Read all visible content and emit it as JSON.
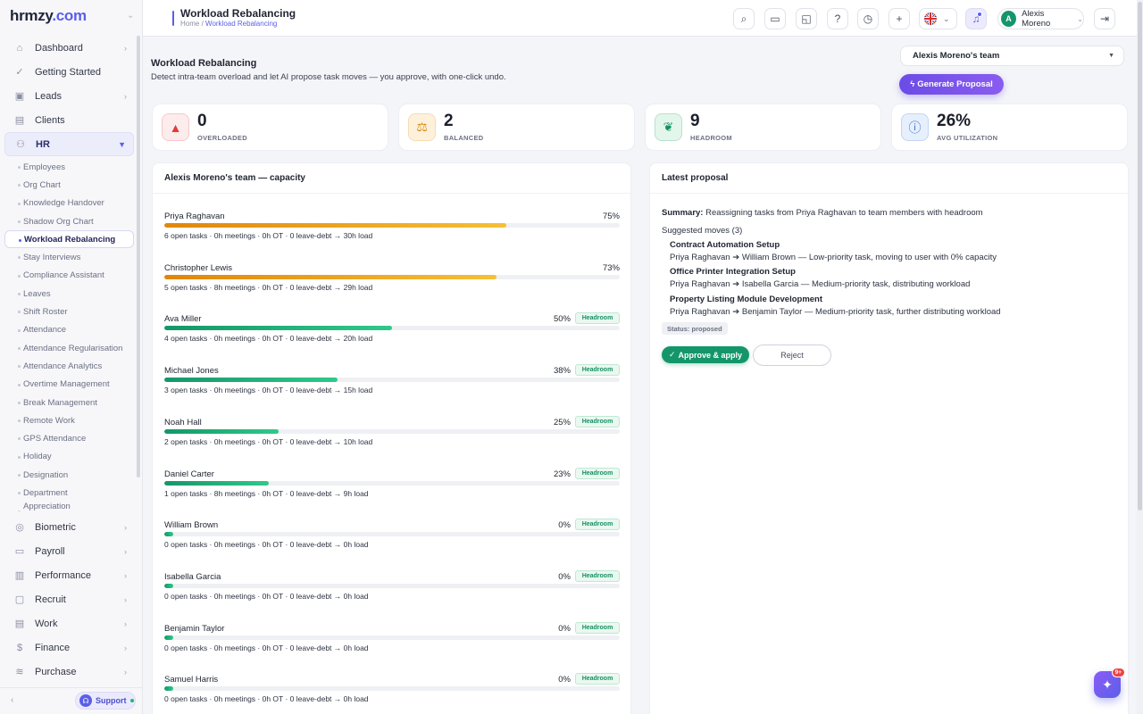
{
  "brand": {
    "logo_text": "hrmzy",
    "logo_suffix": ".com"
  },
  "sidebar": {
    "items_top": [
      {
        "label": "Dashboard",
        "icon": "home-icon",
        "chevron": true
      },
      {
        "label": "Getting Started",
        "icon": "check-circle-icon",
        "chevron": false
      },
      {
        "label": "Leads",
        "icon": "leads-icon",
        "chevron": true
      },
      {
        "label": "Clients",
        "icon": "chart-icon",
        "chevron": false
      },
      {
        "label": "HR",
        "icon": "users-icon",
        "chevron": true,
        "open": true
      }
    ],
    "hr_sub": [
      "Employees",
      "Org Chart",
      "Knowledge Handover",
      "Shadow Org Chart",
      "Workload Rebalancing",
      "Stay Interviews",
      "Compliance Assistant",
      "Leaves",
      "Shift Roster",
      "Attendance",
      "Attendance Regularisation",
      "Attendance Analytics",
      "Overtime Management",
      "Break Management",
      "Remote Work",
      "GPS Attendance",
      "Holiday",
      "Designation",
      "Department",
      "Appreciation"
    ],
    "items_bottom": [
      {
        "label": "Biometric",
        "icon": "fingerprint-icon"
      },
      {
        "label": "Payroll",
        "icon": "wallet-icon"
      },
      {
        "label": "Performance",
        "icon": "bars-icon"
      },
      {
        "label": "Recruit",
        "icon": "id-card-icon"
      },
      {
        "label": "Work",
        "icon": "briefcase-icon"
      },
      {
        "label": "Finance",
        "icon": "dollar-icon"
      },
      {
        "label": "Purchase",
        "icon": "layers-icon"
      }
    ],
    "support_label": "Support"
  },
  "header": {
    "title": "Workload Rebalancing",
    "breadcrumb_home": "Home",
    "breadcrumb_current": "Workload Rebalancing",
    "user_name": "Alexis Moreno",
    "user_initial": "A"
  },
  "page": {
    "title": "Workload Rebalancing",
    "subtitle": "Detect intra-team overload and let AI propose task moves — you approve, with one-click undo.",
    "team_select": "Alexis Moreno's team",
    "generate_label": "Generate Proposal"
  },
  "stats": [
    {
      "value": "0",
      "label": "OVERLOADED",
      "icon": "warning-icon",
      "bg": "#fdecec",
      "fg": "#e23b3b"
    },
    {
      "value": "2",
      "label": "BALANCED",
      "icon": "scale-icon",
      "bg": "#fdf1dc",
      "fg": "#d98a0b"
    },
    {
      "value": "9",
      "label": "HEADROOM",
      "icon": "leaf-icon",
      "bg": "#e3f6ec",
      "fg": "#169064"
    },
    {
      "value": "26%",
      "label": "AVG UTILIZATION",
      "icon": "info-icon",
      "bg": "#e6effc",
      "fg": "#3b6fd0"
    }
  ],
  "capacity": {
    "title": "Alexis Moreno's team — capacity",
    "headroom_label": "Headroom",
    "members": [
      {
        "name": "Priya Raghavan",
        "pct": "75%",
        "level": 75,
        "headroom": false,
        "meta": "6 open tasks · 0h meetings · 0h OT · 0 leave-debt → 30h load"
      },
      {
        "name": "Christopher Lewis",
        "pct": "73%",
        "level": 73,
        "headroom": false,
        "meta": "5 open tasks · 8h meetings · 0h OT · 0 leave-debt → 29h load"
      },
      {
        "name": "Ava Miller",
        "pct": "50%",
        "level": 50,
        "headroom": true,
        "meta": "4 open tasks · 0h meetings · 0h OT · 0 leave-debt → 20h load"
      },
      {
        "name": "Michael Jones",
        "pct": "38%",
        "level": 38,
        "headroom": true,
        "meta": "3 open tasks · 0h meetings · 0h OT · 0 leave-debt → 15h load"
      },
      {
        "name": "Noah Hall",
        "pct": "25%",
        "level": 25,
        "headroom": true,
        "meta": "2 open tasks · 0h meetings · 0h OT · 0 leave-debt → 10h load"
      },
      {
        "name": "Daniel Carter",
        "pct": "23%",
        "level": 23,
        "headroom": true,
        "meta": "1 open tasks · 8h meetings · 0h OT · 0 leave-debt → 9h load"
      },
      {
        "name": "William Brown",
        "pct": "0%",
        "level": 0,
        "headroom": true,
        "meta": "0 open tasks · 0h meetings · 0h OT · 0 leave-debt → 0h load"
      },
      {
        "name": "Isabella Garcia",
        "pct": "0%",
        "level": 0,
        "headroom": true,
        "meta": "0 open tasks · 0h meetings · 0h OT · 0 leave-debt → 0h load"
      },
      {
        "name": "Benjamin Taylor",
        "pct": "0%",
        "level": 0,
        "headroom": true,
        "meta": "0 open tasks · 0h meetings · 0h OT · 0 leave-debt → 0h load"
      },
      {
        "name": "Samuel Harris",
        "pct": "0%",
        "level": 0,
        "headroom": true,
        "meta": "0 open tasks · 0h meetings · 0h OT · 0 leave-debt → 0h load"
      }
    ]
  },
  "proposal": {
    "title": "Latest proposal",
    "summary_label": "Summary:",
    "summary_text": "Reassigning tasks from Priya Raghavan to team members with headroom",
    "moves_label": "Suggested moves (3)",
    "moves": [
      {
        "task": "Contract Automation Setup",
        "from": "Priya Raghavan",
        "to": "William Brown",
        "reason": "— Low-priority task, moving to user with 0% capacity"
      },
      {
        "task": "Office Printer Integration Setup",
        "from": "Priya Raghavan",
        "to": "Isabella Garcia",
        "reason": "— Medium-priority task, distributing workload"
      },
      {
        "task": "Property Listing Module Development",
        "from": "Priya Raghavan",
        "to": "Benjamin Taylor",
        "reason": "— Medium-priority task, further distributing workload"
      }
    ],
    "status": "Status: proposed",
    "approve_label": "Approve & apply",
    "reject_label": "Reject"
  },
  "fab_badge": "9+",
  "colors": {
    "accent": "#5b5fe8",
    "overload_bar": "#e8980e",
    "headroom_bar": "#15966a",
    "success": "#15966a"
  }
}
